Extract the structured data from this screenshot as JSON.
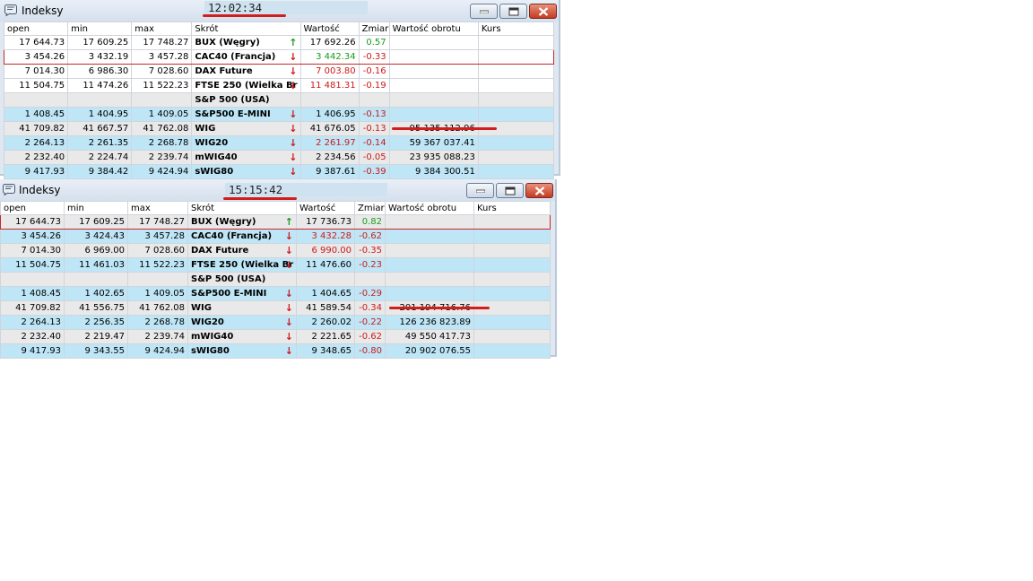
{
  "colors": {
    "up": "#169c1e",
    "down": "#cc1a1a",
    "highlight": "#c62828",
    "row_blue": "#bfe6f6",
    "row_gray": "#e9e9e9"
  },
  "columns": [
    "open",
    "min",
    "max",
    "Skrót",
    "Wartość",
    "Zmiar",
    "Wartość obrotu",
    "Kurs"
  ],
  "windows": [
    {
      "title": "Indeksy",
      "clock": "12:02:34",
      "rows": [
        {
          "open": "17 644.73",
          "min": "17 609.25",
          "max": "17 748.27",
          "name": "BUX (Węgry)",
          "arrow": "up",
          "value": "17 692.26",
          "change": "0.57",
          "turnover": "",
          "kurs": "",
          "style": "white",
          "value_color": "black",
          "change_color": "green",
          "highlight": false
        },
        {
          "open": "3 454.26",
          "min": "3 432.19",
          "max": "3 457.28",
          "name": "CAC40 (Francja)",
          "arrow": "down",
          "value": "3 442.34",
          "change": "-0.33",
          "turnover": "",
          "kurs": "",
          "style": "white",
          "value_color": "green",
          "change_color": "red",
          "highlight": true
        },
        {
          "open": "7 014.30",
          "min": "6 986.30",
          "max": "7 028.60",
          "name": "DAX Future",
          "arrow": "down",
          "value": "7 003.80",
          "change": "-0.16",
          "turnover": "",
          "kurs": "",
          "style": "white",
          "value_color": "red",
          "change_color": "red",
          "highlight": false
        },
        {
          "open": "11 504.75",
          "min": "11 474.26",
          "max": "11 522.23",
          "name": "FTSE 250 (Wielka Br",
          "arrow": "down",
          "value": "11 481.31",
          "change": "-0.19",
          "turnover": "",
          "kurs": "",
          "style": "white",
          "value_color": "red",
          "change_color": "red",
          "highlight": false
        },
        {
          "open": "",
          "min": "",
          "max": "",
          "name": "S&P 500 (USA)",
          "arrow": "",
          "value": "",
          "change": "",
          "turnover": "",
          "kurs": "",
          "style": "gray",
          "value_color": "black",
          "change_color": "black",
          "highlight": false
        },
        {
          "open": "1 408.45",
          "min": "1 404.95",
          "max": "1 409.05",
          "name": "S&P500 E-MINI",
          "arrow": "down",
          "value": "1 406.95",
          "change": "-0.13",
          "turnover": "",
          "kurs": "",
          "style": "blue",
          "value_color": "black",
          "change_color": "red",
          "highlight": false
        },
        {
          "open": "41 709.82",
          "min": "41 667.57",
          "max": "41 762.08",
          "name": "WIG",
          "arrow": "down",
          "value": "41 676.05",
          "change": "-0.13",
          "turnover": "95 135 112.96",
          "kurs": "",
          "style": "gray",
          "value_color": "black",
          "change_color": "red",
          "highlight": false
        },
        {
          "open": "2 264.13",
          "min": "2 261.35",
          "max": "2 268.78",
          "name": "WIG20",
          "arrow": "down",
          "value": "2 261.97",
          "change": "-0.14",
          "turnover": "59 367 037.41",
          "kurs": "",
          "style": "blue",
          "value_color": "red",
          "change_color": "red",
          "highlight": false
        },
        {
          "open": "2 232.40",
          "min": "2 224.74",
          "max": "2 239.74",
          "name": "mWIG40",
          "arrow": "down",
          "value": "2 234.56",
          "change": "-0.05",
          "turnover": "23 935 088.23",
          "kurs": "",
          "style": "gray",
          "value_color": "black",
          "change_color": "red",
          "highlight": false
        },
        {
          "open": "9 417.93",
          "min": "9 384.42",
          "max": "9 424.94",
          "name": "sWIG80",
          "arrow": "down",
          "value": "9 387.61",
          "change": "-0.39",
          "turnover": "9 384 300.51",
          "kurs": "",
          "style": "blue",
          "value_color": "black",
          "change_color": "red",
          "highlight": false
        }
      ]
    },
    {
      "title": "Indeksy",
      "clock": "15:15:42",
      "rows": [
        {
          "open": "17 644.73",
          "min": "17 609.25",
          "max": "17 748.27",
          "name": "BUX (Węgry)",
          "arrow": "up",
          "value": "17 736.73",
          "change": "0.82",
          "turnover": "",
          "kurs": "",
          "style": "gray",
          "value_color": "black",
          "change_color": "green",
          "highlight": true
        },
        {
          "open": "3 454.26",
          "min": "3 424.43",
          "max": "3 457.28",
          "name": "CAC40 (Francja)",
          "arrow": "down",
          "value": "3 432.28",
          "change": "-0.62",
          "turnover": "",
          "kurs": "",
          "style": "blue",
          "value_color": "red",
          "change_color": "red",
          "highlight": false
        },
        {
          "open": "7 014.30",
          "min": "6 969.00",
          "max": "7 028.60",
          "name": "DAX Future",
          "arrow": "down",
          "value": "6 990.00",
          "change": "-0.35",
          "turnover": "",
          "kurs": "",
          "style": "gray",
          "value_color": "red",
          "change_color": "red",
          "highlight": false
        },
        {
          "open": "11 504.75",
          "min": "11 461.03",
          "max": "11 522.23",
          "name": "FTSE 250 (Wielka Br",
          "arrow": "down",
          "value": "11 476.60",
          "change": "-0.23",
          "turnover": "",
          "kurs": "",
          "style": "blue",
          "value_color": "black",
          "change_color": "red",
          "highlight": false
        },
        {
          "open": "",
          "min": "",
          "max": "",
          "name": "S&P 500 (USA)",
          "arrow": "",
          "value": "",
          "change": "",
          "turnover": "",
          "kurs": "",
          "style": "gray",
          "value_color": "black",
          "change_color": "black",
          "highlight": false
        },
        {
          "open": "1 408.45",
          "min": "1 402.65",
          "max": "1 409.05",
          "name": "S&P500 E-MINI",
          "arrow": "down",
          "value": "1 404.65",
          "change": "-0.29",
          "turnover": "",
          "kurs": "",
          "style": "blue",
          "value_color": "black",
          "change_color": "red",
          "highlight": false
        },
        {
          "open": "41 709.82",
          "min": "41 556.75",
          "max": "41 762.08",
          "name": "WIG",
          "arrow": "down",
          "value": "41 589.54",
          "change": "-0.34",
          "turnover": "201 194 716.76",
          "kurs": "",
          "style": "gray",
          "value_color": "black",
          "change_color": "red",
          "highlight": false
        },
        {
          "open": "2 264.13",
          "min": "2 256.35",
          "max": "2 268.78",
          "name": "WIG20",
          "arrow": "down",
          "value": "2 260.02",
          "change": "-0.22",
          "turnover": "126 236 823.89",
          "kurs": "",
          "style": "blue",
          "value_color": "black",
          "change_color": "red",
          "highlight": false
        },
        {
          "open": "2 232.40",
          "min": "2 219.47",
          "max": "2 239.74",
          "name": "mWIG40",
          "arrow": "down",
          "value": "2 221.65",
          "change": "-0.62",
          "turnover": "49 550 417.73",
          "kurs": "",
          "style": "gray",
          "value_color": "black",
          "change_color": "red",
          "highlight": false
        },
        {
          "open": "9 417.93",
          "min": "9 343.55",
          "max": "9 424.94",
          "name": "sWIG80",
          "arrow": "down",
          "value": "9 348.65",
          "change": "-0.80",
          "turnover": "20 902 076.55",
          "kurs": "",
          "style": "blue",
          "value_color": "black",
          "change_color": "red",
          "highlight": false
        }
      ]
    }
  ]
}
